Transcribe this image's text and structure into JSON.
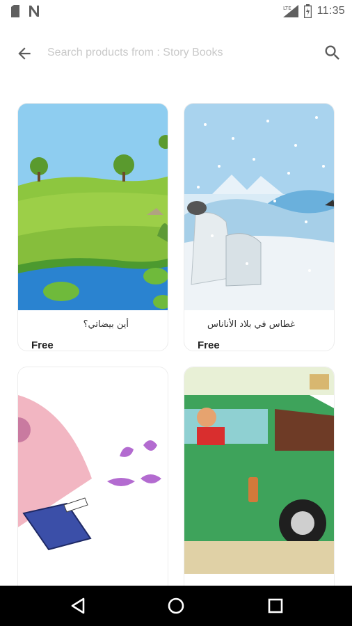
{
  "status_bar": {
    "time": "11:35",
    "network_label": "LTE",
    "icons": [
      "sd-card-icon",
      "n-notification-icon",
      "signal-icon",
      "battery-icon"
    ]
  },
  "search": {
    "placeholder": "Search products from : Story Books",
    "value": ""
  },
  "products": [
    {
      "title": "أين بيضاتي؟",
      "price": "Free",
      "cover": "pond-meadow-illustration"
    },
    {
      "title": "غطاس في بلاد الأناناس",
      "price": "Free",
      "cover": "snowy-hills-illustration"
    },
    {
      "title": "",
      "price": "",
      "cover": "pink-book-illustration"
    },
    {
      "title": "",
      "price": "",
      "cover": "green-car-illustration"
    }
  ],
  "nav_bar": {
    "icons": [
      "back-triangle-icon",
      "home-circle-icon",
      "recents-square-icon"
    ]
  },
  "colors": {
    "status_icons": "#5f5f5f",
    "card_border": "#ececec",
    "nav_background": "#000000"
  }
}
